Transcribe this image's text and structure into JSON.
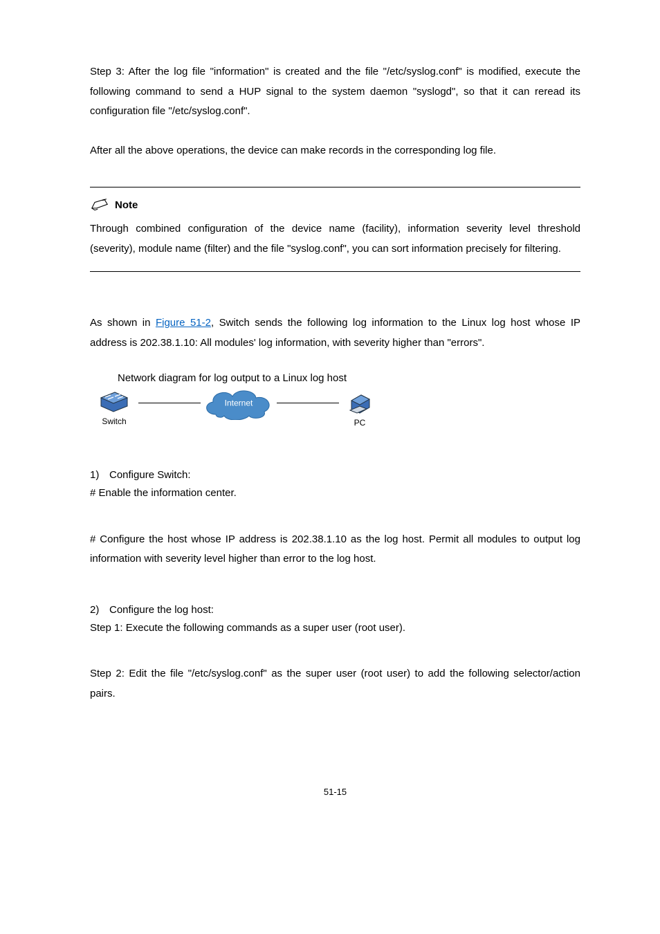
{
  "para1": "Step 3: After the log file \"information\" is created and the file \"/etc/syslog.conf\" is modified, execute the following command to send a HUP signal to the system daemon \"syslogd\", so that it can reread its configuration file \"/etc/syslog.conf\".",
  "para2": "After all the above operations, the device can make records in the corresponding log file.",
  "note": {
    "title": "Note",
    "text": "Through combined configuration of the device name (facility), information severity level threshold (severity), module name (filter) and the file \"syslog.conf\", you can sort information precisely for filtering."
  },
  "para3_prefix": "As shown in ",
  "para3_link": "Figure 51-2",
  "para3_suffix": ", Switch sends the following log information to the Linux log host whose IP address is 202.38.1.10: All modules' log information, with severity higher than \"errors\".",
  "fig_caption": "Network diagram for log output to a Linux log host",
  "diagram": {
    "switch_label": "Switch",
    "cloud_label": "Internet",
    "pc_label": "PC"
  },
  "step1_num": "1)",
  "step1_text": "Configure Switch:",
  "step1_sub": "# Enable the information center.",
  "para4": "# Configure the host whose IP address is 202.38.1.10 as the log host. Permit all modules to output log information with severity level higher than error to the log host.",
  "step2_num": "2)",
  "step2_text": "Configure the log host:",
  "step2_sub": "Step 1: Execute the following commands as a super user (root user).",
  "para5": "Step 2: Edit the file \"/etc/syslog.conf\" as the super user (root user) to add the following selector/action pairs.",
  "footer": "51-15"
}
